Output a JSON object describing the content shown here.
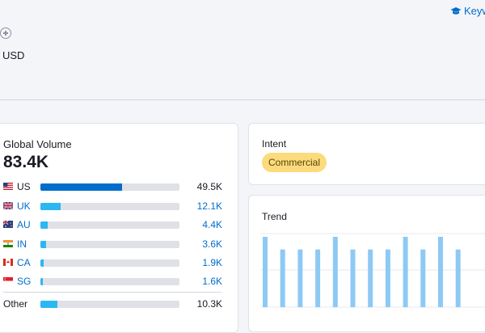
{
  "header": {
    "currency": "USD",
    "keyword_link": "Keyw"
  },
  "global_volume": {
    "title": "Global Volume",
    "value": "83.4K",
    "rows": [
      {
        "code": "US",
        "flag": "us-flag-icon",
        "value": "49.5K",
        "fraction": 0.59,
        "link": false
      },
      {
        "code": "UK",
        "flag": "uk-flag-icon",
        "value": "12.1K",
        "fraction": 0.145,
        "link": true
      },
      {
        "code": "AU",
        "flag": "au-flag-icon",
        "value": "4.4K",
        "fraction": 0.053,
        "link": true
      },
      {
        "code": "IN",
        "flag": "in-flag-icon",
        "value": "3.6K",
        "fraction": 0.043,
        "link": true
      },
      {
        "code": "CA",
        "flag": "ca-flag-icon",
        "value": "1.9K",
        "fraction": 0.023,
        "link": true
      },
      {
        "code": "SG",
        "flag": "sg-flag-icon",
        "value": "1.6K",
        "fraction": 0.019,
        "link": true
      }
    ],
    "other": {
      "label": "Other",
      "value": "10.3K",
      "fraction": 0.123
    }
  },
  "intent": {
    "title": "Intent",
    "badge": "Commercial"
  },
  "trend": {
    "title": "Trend",
    "values": [
      1.0,
      0.82,
      0.82,
      0.82,
      1.0,
      0.82,
      0.82,
      0.82,
      1.0,
      0.82,
      1.0,
      0.82
    ]
  },
  "colors": {
    "primary": "#006dca",
    "secondary_bar": "#2bb7f2",
    "trend_bar": "#8ec9f5",
    "badge": "#fcdb7e"
  }
}
